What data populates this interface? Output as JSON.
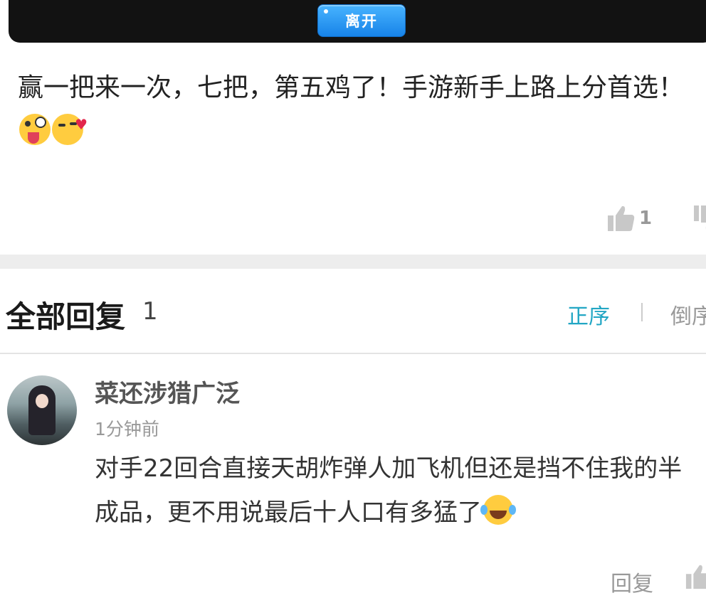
{
  "top_banner": {
    "leave_button_label": "离开"
  },
  "post": {
    "text": "赢一把来一次，七把，第五鸡了！手游新手上路上分首选！",
    "emojis": [
      "tongue-wink-icon",
      "kiss-wink-icon"
    ],
    "like_count": "1"
  },
  "replies": {
    "title": "全部回复",
    "count": "1",
    "sort_asc_label": "正序",
    "sort_desc_label": "倒序",
    "items": [
      {
        "username": "菜还涉猎广泛",
        "time": "1分钟前",
        "text": "对手22回合直接天胡炸弹人加飞机但还是挡不住我的半成品，更不用说最后十人口有多猛了",
        "emoji": "tears-of-joy-icon",
        "reply_label": "回复"
      }
    ]
  },
  "colors": {
    "accent": "#22a6c4",
    "button_blue": "#1783e8",
    "muted": "#999999",
    "band": "#ededed"
  }
}
